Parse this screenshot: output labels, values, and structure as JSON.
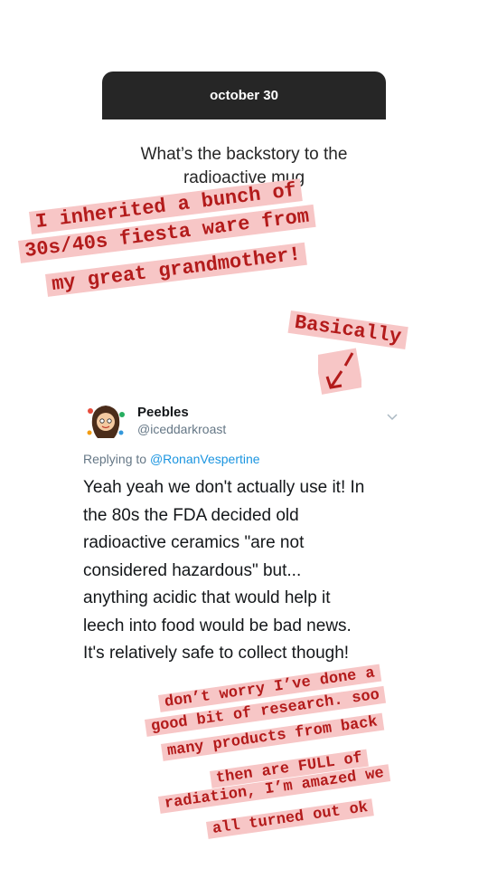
{
  "question": {
    "date": "october 30",
    "text": "What’s the backstory to the radioactive mug"
  },
  "annotations": {
    "top_lines": [
      "I inherited a bunch of",
      "30s/40s fiesta ware from",
      "my great grandmother!"
    ],
    "basically": "Basically",
    "bottom_lines": [
      "don’t worry I’ve done a",
      "good bit of research. soo",
      "many products from back",
      "then are FULL of",
      "radiation, I’m amazed we",
      "all turned out ok"
    ],
    "highlight_color": "#f7c6c6",
    "ink_color": "#b31b1b"
  },
  "tweet": {
    "name": "Peebles",
    "handle": "@iceddarkroast",
    "replying_to_prefix": "Replying to",
    "replying_to_handle": "@RonanVespertine",
    "body_lines": [
      "Yeah yeah we don't actually use it! In",
      "the 80s the FDA decided old",
      "radioactive ceramics \"are not",
      "considered hazardous\" but...",
      "anything acidic that would help it",
      "leech into food would be bad news.",
      "It's relatively safe to collect though!"
    ],
    "avatar_icon": "cartoon-avatar",
    "menu_icon": "chevron-down-icon"
  }
}
